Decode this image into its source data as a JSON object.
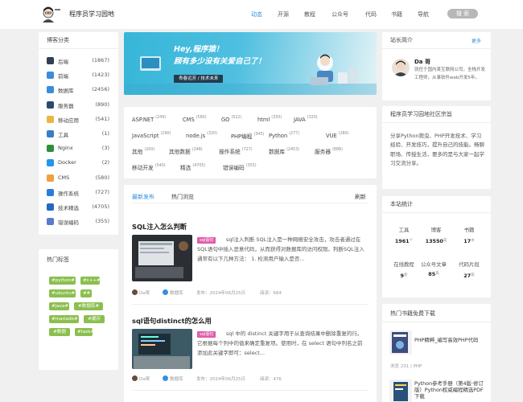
{
  "site": {
    "title": "程序员学习园地"
  },
  "nav": [
    "动态",
    "开源",
    "教程",
    "公众号",
    "代码",
    "书籍",
    "导航"
  ],
  "search_label": "搜 索",
  "blog_categories": {
    "title": "博客分类",
    "items": [
      {
        "label": "后端",
        "count": "(1867)",
        "color": "#2f4050"
      },
      {
        "label": "前端",
        "count": "(1423)",
        "color": "#3a8dde"
      },
      {
        "label": "数据库",
        "count": "(2456)",
        "color": "#3a8dde"
      },
      {
        "label": "服务器",
        "count": "(890)",
        "color": "#2c4a6e"
      },
      {
        "label": "移动应用",
        "count": "(541)",
        "color": "#e8b83e"
      },
      {
        "label": "工具",
        "count": "(1)",
        "color": "#3a7ec8"
      },
      {
        "label": "Nginx",
        "count": "(3)",
        "color": "#2f8f3a"
      },
      {
        "label": "Docker",
        "count": "(2)",
        "color": "#2496ed"
      },
      {
        "label": "CMS",
        "count": "(580)",
        "color": "#f0a040"
      },
      {
        "label": "操作系统",
        "count": "(727)",
        "color": "#2a7fd4"
      },
      {
        "label": "技术精选",
        "count": "(4705)",
        "color": "#2a66c4"
      },
      {
        "label": "错误编码",
        "count": "(355)",
        "color": "#5a7ad0"
      }
    ]
  },
  "hot_tags": {
    "title": "热门标签",
    "tags": [
      "#python#",
      "#c++#",
      "#ubuntu#",
      "##",
      "#java#",
      "#数据库#",
      "#mariadb#",
      "#缓存#",
      "#数据#",
      "#task#"
    ]
  },
  "banner": {
    "line1": "Hey,程序猿！",
    "line2": "顾有多少没有关爱自己了！",
    "pill": "青春远芳 / 技术未来"
  },
  "keywords": [
    {
      "label": "ASP.NET",
      "count": "249"
    },
    {
      "label": "CMS",
      "count": "580"
    },
    {
      "label": "GO",
      "count": "522"
    },
    {
      "label": "html",
      "count": "330"
    },
    {
      "label": "JAVA",
      "count": "320"
    },
    {
      "label": "JavaScript",
      "count": "290"
    },
    {
      "label": "node.js",
      "count": "320"
    },
    {
      "label": "PHP编程",
      "count": "345"
    },
    {
      "label": "Python",
      "count": "277"
    },
    {
      "label": "VUE",
      "count": "280"
    },
    {
      "label": "其他",
      "count": "200"
    },
    {
      "label": "其他数据",
      "count": "248"
    },
    {
      "label": "操作系统",
      "count": "727"
    },
    {
      "label": "数据库",
      "count": "2453"
    },
    {
      "label": "服务器",
      "count": "888"
    },
    {
      "label": "移动开发",
      "count": "540"
    },
    {
      "label": "精选",
      "count": "4705"
    },
    {
      "label": "错误编码",
      "count": "355"
    }
  ],
  "list_tabs": {
    "latest": "最新发布",
    "hot": "热门浏览",
    "refresh": "刷新"
  },
  "articles": [
    {
      "title": "SQL注入怎么判断",
      "tag": "sql语句",
      "desc": "sql注入判断 SQL注入是一种网络安全攻击，攻击者通过在SQL语句中插入恶意代码，从而获得对数据库的访问权限。判断SQL注入通常有以下几种方法： 1. 检测用户输入是否...",
      "author": "Da哥",
      "category": "数据库",
      "date": "发布：2024年06月25日",
      "views": "阅读：684"
    },
    {
      "title": "sql语句distinct的怎么用",
      "tag": "sql语句",
      "desc": "sql 中的 distinct 关键字用于从查询结果中删除重复的行。它根据每个列中的值来确定重复项。使用时，在 select 语句中列名之前添加此关键字即可：select...",
      "author": "Da哥",
      "category": "数据库",
      "date": "发布：2024年06月25日",
      "views": "阅读：476"
    }
  ],
  "owner": {
    "title": "站长简介",
    "more": "更多",
    "name": "Da 哥",
    "bio": "就任于国内某互联网公司，全栈开发工程师，从事软件web开发5年。"
  },
  "intro": {
    "title": "程序员学习园地社区宗旨",
    "text": "分享Python爬虫、PHP开发技术、学习经验、开发技巧，提升自己的技能。畅聊职场、传授生活，要多的是与大家一起学习交流分享。"
  },
  "stats": {
    "title": "本站统计",
    "items": [
      {
        "label": "工具",
        "value": "1961",
        "unit": "个"
      },
      {
        "label": "博客",
        "value": "13550",
        "unit": "篇"
      },
      {
        "label": "书籍",
        "value": "17",
        "unit": "本"
      },
      {
        "label": "在线教程",
        "value": "9",
        "unit": "套"
      },
      {
        "label": "公众号文章",
        "value": "85",
        "unit": "篇"
      },
      {
        "label": "代码片段",
        "value": "27",
        "unit": "篇"
      }
    ]
  },
  "books": {
    "title": "热门书籍免费下载",
    "items": [
      {
        "title": "PHP精粹_编写高效PHP代码",
        "meta": "浏览 231 | PHP"
      },
      {
        "title": "Python参考手册（第4版·修订版）Python权威编程精选PDF下载",
        "meta": ""
      }
    ]
  }
}
